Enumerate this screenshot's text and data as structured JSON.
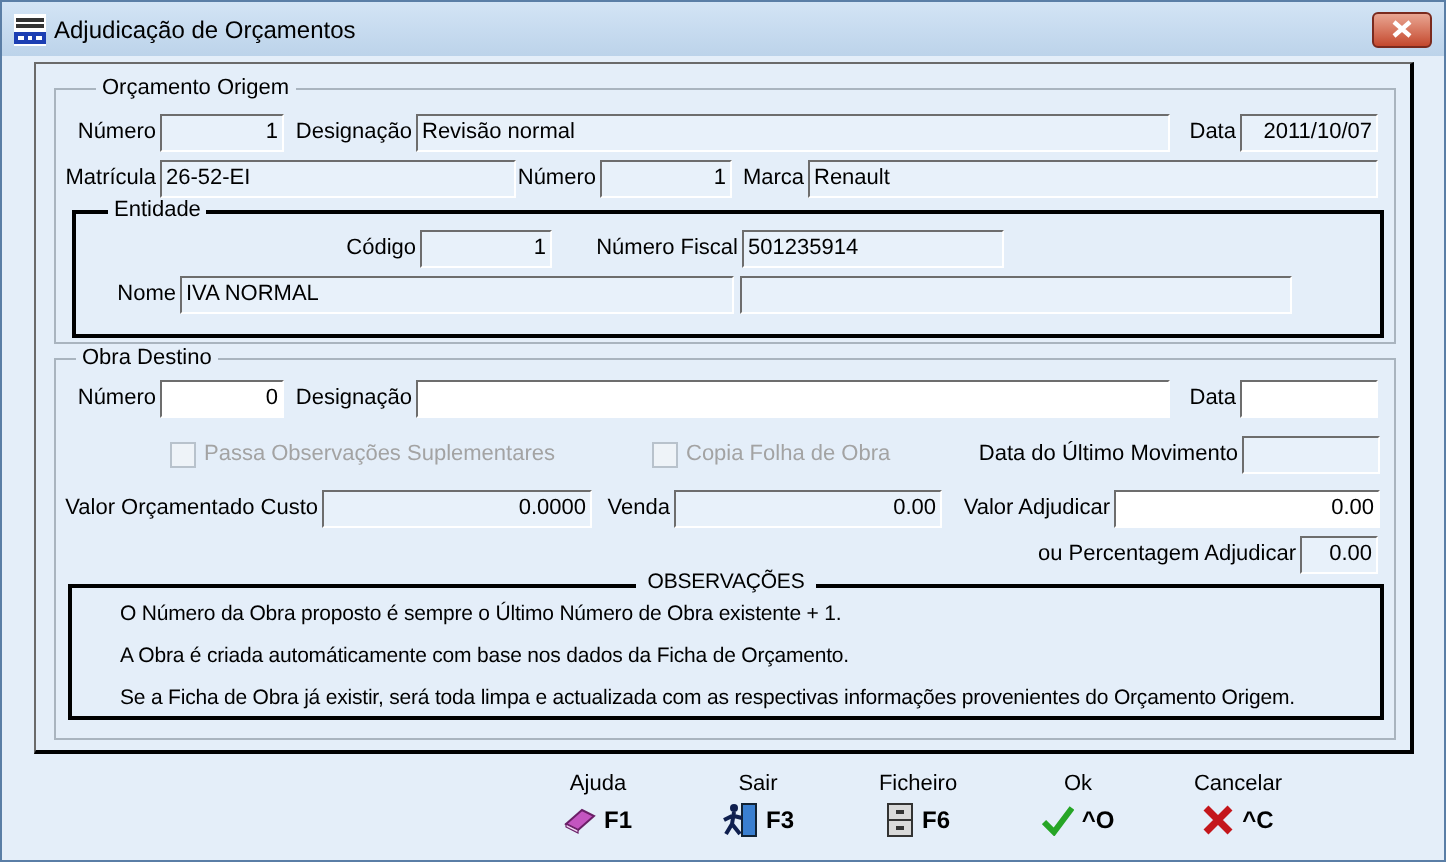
{
  "window": {
    "title": "Adjudicação de Orçamentos"
  },
  "orcamento_origem": {
    "title": "Orçamento Origem",
    "row_1": [
      {
        "label": "Número",
        "value": "1",
        "kind": "number",
        "editable": false
      },
      {
        "label": "Designação",
        "value": "Revisão normal",
        "editable": false
      },
      {
        "label": "Data",
        "value": "2011/10/07",
        "kind": "number",
        "editable": false
      }
    ],
    "row_2": [
      {
        "label": "Matrícula",
        "value": "26-52-EI",
        "editable": false
      },
      {
        "label": "Número",
        "value": "1",
        "kind": "number",
        "editable": false
      },
      {
        "label": "Marca",
        "value": "Renault",
        "editable": false
      }
    ],
    "entidade": {
      "title": "Entidade",
      "row_1": [
        {
          "label": "Código",
          "value": "1",
          "kind": "number",
          "editable": false
        },
        {
          "label": "Número Fiscal",
          "value": "501235914",
          "editable": false
        }
      ],
      "row_2": [
        {
          "label": "Nome",
          "value": "IVA NORMAL",
          "editable": false
        },
        {
          "editable": false
        }
      ]
    }
  },
  "obra_destino": {
    "title": "Obra Destino",
    "row_1": [
      {
        "label": "Número",
        "value": "0",
        "kind": "number",
        "editable": true
      },
      {
        "label": "Designação",
        "editable": true
      },
      {
        "label": "Data",
        "editable": true
      }
    ],
    "checkboxes": [
      {
        "label": "Passa Observações Suplementares",
        "checked": false,
        "disabled": true
      },
      {
        "label": "Copia Folha de Obra",
        "checked": false,
        "disabled": true
      }
    ],
    "ultimo_movimento": {
      "label": "Data do Último Movimento",
      "editable": false
    },
    "row_3": [
      {
        "label": "Valor Orçamentado Custo",
        "value": "0.0000",
        "kind": "number",
        "editable": false
      },
      {
        "label": "Venda",
        "value": "0.00",
        "kind": "number",
        "editable": false
      },
      {
        "label": "Valor Adjudicar",
        "value": "0.00",
        "kind": "number",
        "editable": true
      }
    ],
    "percentagem": {
      "label": "ou Percentagem Adjudicar",
      "value": "0.00",
      "kind": "number",
      "editable": false
    },
    "observacoes": {
      "title": "OBSERVAÇÕES",
      "lines": [
        "O Número da Obra proposto é sempre o Último Número de Obra existente + 1.",
        "A Obra é criada automáticamente com base nos dados da Ficha de Orçamento.",
        "Se a Ficha de Obra já existir, será toda limpa e actualizada com as respectivas informações provenientes do Orçamento Origem."
      ]
    }
  },
  "buttons": [
    {
      "label": "Ajuda",
      "key": "F1"
    },
    {
      "label": "Sair",
      "key": "F3"
    },
    {
      "label": "Ficheiro",
      "key": "F6"
    },
    {
      "label": "Ok",
      "key": "^O"
    },
    {
      "label": "Cancelar",
      "key": "^C"
    }
  ]
}
